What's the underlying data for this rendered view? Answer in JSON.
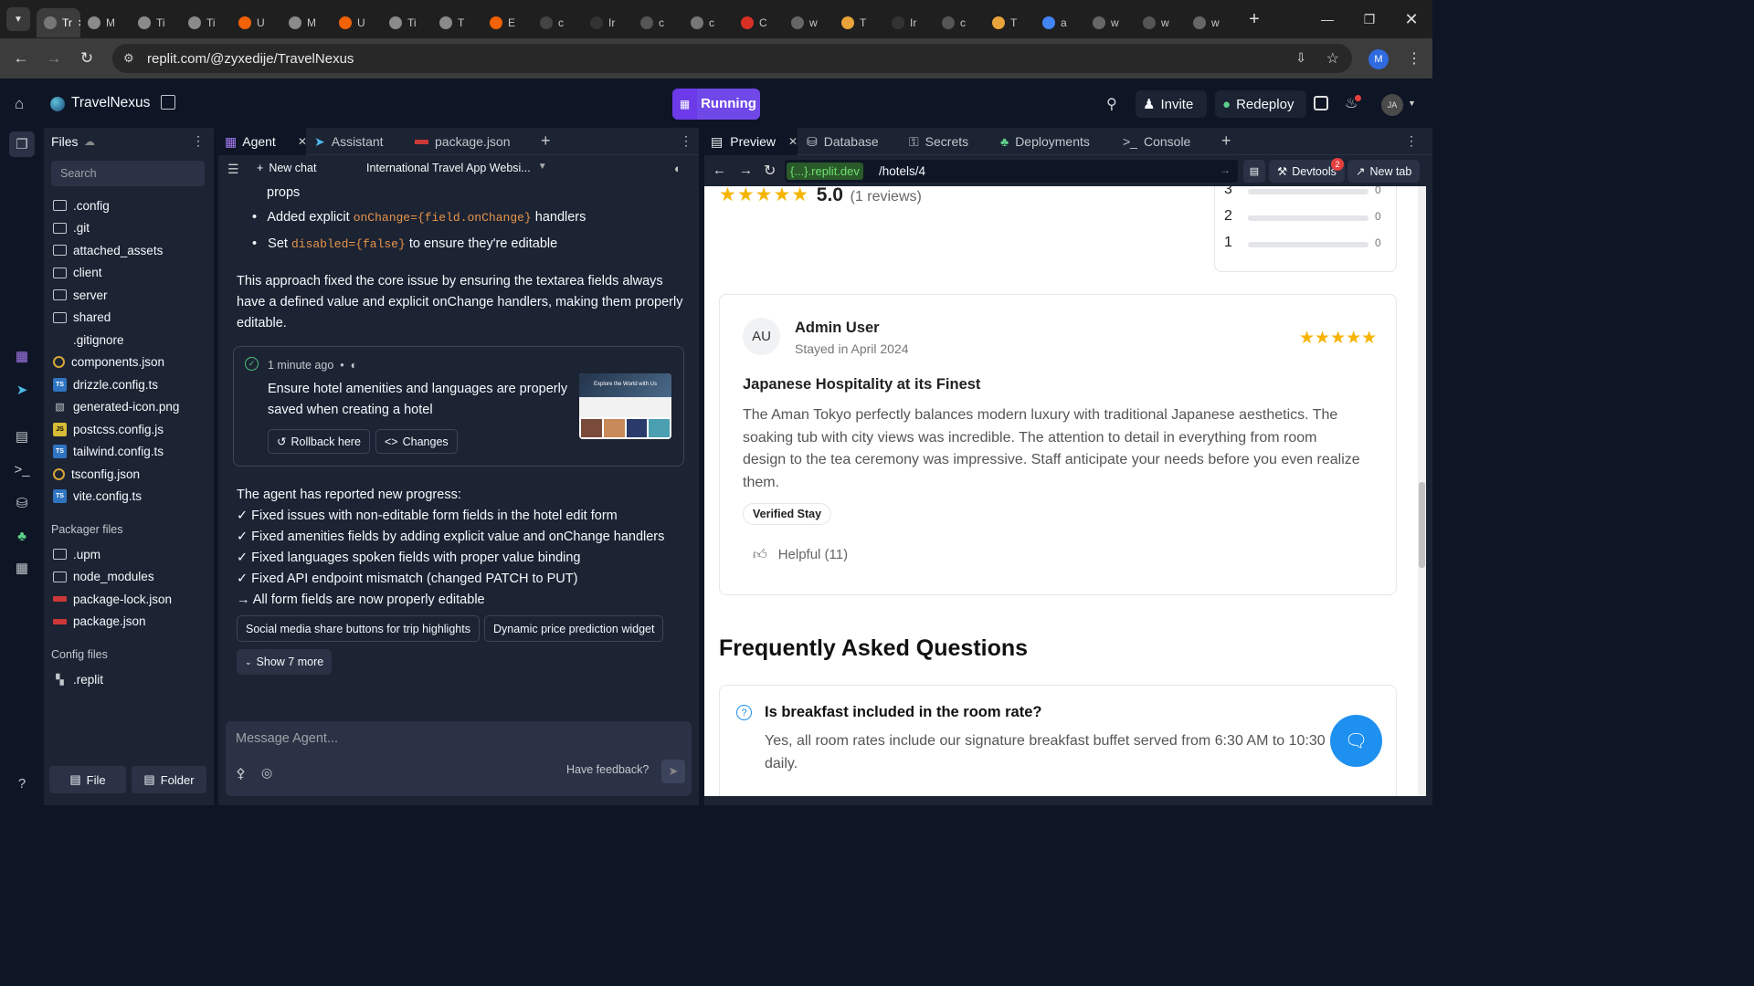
{
  "browser": {
    "tabs": [
      {
        "label": "Tr",
        "color": "#777",
        "icon": "replit-favicon"
      },
      {
        "label": "M",
        "color": "#8a8a8a",
        "icon": "web-icon"
      },
      {
        "label": "Ti",
        "color": "#8a8a8a",
        "icon": "web-icon"
      },
      {
        "label": "Ti",
        "color": "#8a8a8a",
        "icon": "web-icon"
      },
      {
        "label": "U",
        "color": "#f26207",
        "icon": "replit-icon"
      },
      {
        "label": "M",
        "color": "#8a8a8a",
        "icon": "web-icon"
      },
      {
        "label": "U",
        "color": "#f26207",
        "icon": "replit-icon"
      },
      {
        "label": "Ti",
        "color": "#8a8a8a",
        "icon": "web-icon"
      },
      {
        "label": "T",
        "color": "#8a8a8a",
        "icon": "web-icon"
      },
      {
        "label": "E",
        "color": "#f26207",
        "icon": "replit-icon"
      },
      {
        "label": "c",
        "color": "#444",
        "icon": "notion-icon"
      },
      {
        "label": "Ir",
        "color": "#333",
        "icon": "openai-icon"
      },
      {
        "label": "c",
        "color": "#555",
        "icon": "openai-icon"
      },
      {
        "label": "c",
        "color": "#777",
        "icon": "web-icon"
      },
      {
        "label": "C",
        "color": "#d93025",
        "icon": "gmail-icon"
      },
      {
        "label": "w",
        "color": "#666",
        "icon": "google-icon"
      },
      {
        "label": "T",
        "color": "#e8a33a",
        "icon": "mail-icon"
      },
      {
        "label": "Ir",
        "color": "#333",
        "icon": "openai-icon"
      },
      {
        "label": "c",
        "color": "#555",
        "icon": "openai-icon"
      },
      {
        "label": "T",
        "color": "#e8a33a",
        "icon": "mail-icon"
      },
      {
        "label": "a",
        "color": "#4285f4",
        "icon": "google-icon"
      },
      {
        "label": "w",
        "color": "#666",
        "icon": "google-icon"
      },
      {
        "label": "w",
        "color": "#555",
        "icon": "web-icon"
      },
      {
        "label": "w",
        "color": "#666",
        "icon": "google-icon"
      }
    ],
    "url": "replit.com/@zyxedije/TravelNexus",
    "profile_initial": "M"
  },
  "header": {
    "project_name": "TravelNexus",
    "run_label": "Running",
    "invite_label": "Invite",
    "redeploy_label": "Redeploy",
    "user_initials": "JA"
  },
  "files": {
    "title": "Files",
    "search_placeholder": "Search",
    "items": [
      {
        "name": ".config",
        "type": "folder"
      },
      {
        "name": ".git",
        "type": "folder"
      },
      {
        "name": "attached_assets",
        "type": "folder"
      },
      {
        "name": "client",
        "type": "folder"
      },
      {
        "name": "server",
        "type": "folder"
      },
      {
        "name": "shared",
        "type": "folder"
      },
      {
        "name": ".gitignore",
        "type": "file"
      },
      {
        "name": "components.json",
        "type": "cfg"
      },
      {
        "name": "drizzle.config.ts",
        "type": "ts"
      },
      {
        "name": "generated-icon.png",
        "type": "img"
      },
      {
        "name": "postcss.config.js",
        "type": "js"
      },
      {
        "name": "tailwind.config.ts",
        "type": "ts"
      },
      {
        "name": "tsconfig.json",
        "type": "cfg"
      },
      {
        "name": "vite.config.ts",
        "type": "ts"
      }
    ],
    "packager_title": "Packager files",
    "packager_items": [
      {
        "name": ".upm",
        "type": "folder"
      },
      {
        "name": "node_modules",
        "type": "folder"
      },
      {
        "name": "package-lock.json",
        "type": "npm"
      },
      {
        "name": "package.json",
        "type": "npm"
      }
    ],
    "config_title": "Config files",
    "config_items": [
      {
        "name": ".replit",
        "type": "replit"
      }
    ],
    "new_file_label": "File",
    "new_folder_label": "Folder"
  },
  "agent": {
    "tabs": [
      {
        "label": "Agent"
      },
      {
        "label": "Assistant"
      },
      {
        "label": "package.json"
      }
    ],
    "new_chat_label": "New chat",
    "chat_title": "International Travel App Websi...",
    "line_props": "props",
    "bullet1_pre": "Added explicit",
    "bullet1_code": "onChange={field.onChange}",
    "bullet1_post": "handlers",
    "bullet2_pre": "Set",
    "bullet2_code": "disabled={false}",
    "bullet2_post": "to ensure they're editable",
    "paragraph1": "This approach fixed the core issue by ensuring the textarea fields always",
    "paragraph2": "have a defined value and explicit onChange handlers, making them properly",
    "paragraph3": "editable.",
    "checkpoint": {
      "time": "1 minute ago",
      "title1": "Ensure hotel amenities and languages are properly",
      "title2": "saved when creating a hotel",
      "rollback_label": "Rollback here",
      "changes_label": "Changes",
      "thumb_heading": "Explore the World with Us"
    },
    "progress": [
      "The agent has reported new progress:",
      "✓ Fixed issues with non-editable form fields in the hotel edit form",
      "✓ Fixed amenities fields by adding explicit value and onChange handlers",
      "✓ Fixed languages spoken fields with proper value binding",
      "✓ Fixed API endpoint mismatch (changed PATCH to PUT)",
      "→ All form fields are now properly editable"
    ],
    "suggestions": [
      "Social media share buttons for trip highlights",
      "Dynamic price prediction widget"
    ],
    "show_more_label": "Show 7 more",
    "input_placeholder": "Message Agent...",
    "feedback_label": "Have feedback?"
  },
  "preview": {
    "tabs": [
      {
        "label": "Preview"
      },
      {
        "label": "Database"
      },
      {
        "label": "Secrets"
      },
      {
        "label": "Deployments"
      },
      {
        "label": "Console"
      }
    ],
    "domain": "{...}.replit.dev",
    "path": "/hotels/4",
    "devtools_label": "Devtools",
    "devtools_badge": "2",
    "new_tab_label": "New tab"
  },
  "page": {
    "rating_value": "5.0",
    "rating_count": "(1 reviews)",
    "breakdown": [
      {
        "star": "3",
        "count": "0"
      },
      {
        "star": "2",
        "count": "0"
      },
      {
        "star": "1",
        "count": "0"
      }
    ],
    "review": {
      "avatar": "AU",
      "name": "Admin User",
      "stay": "Stayed in April 2024",
      "rating": 5,
      "title": "Japanese Hospitality at its Finest",
      "body1": "The Aman Tokyo perfectly balances modern luxury with traditional Japanese aesthetics. The",
      "body2": "soaking tub with city views was incredible. The attention to detail in everything from room",
      "body3": "design to the tea ceremony was impressive. Staff anticipate your needs before you even realize",
      "body4": "them.",
      "badge": "Verified Stay",
      "helpful": "Helpful (11)"
    },
    "faq_title": "Frequently Asked Questions",
    "faq_q": "Is breakfast included in the room rate?",
    "faq_a1": "Yes, all room rates include our signature breakfast buffet served from 6:30 AM to 10:30",
    "faq_a2": "daily."
  }
}
